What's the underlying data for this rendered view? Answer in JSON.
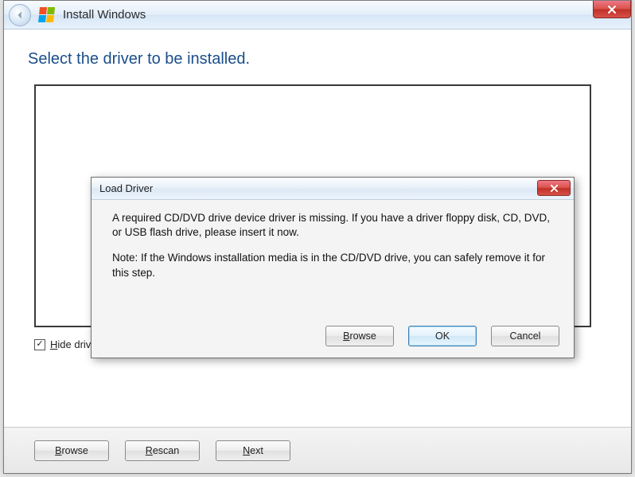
{
  "titlebar": {
    "title": "Install Windows"
  },
  "main": {
    "heading": "Select the driver to be installed.",
    "hide_checkbox_label": "Hide drivers that are not compatible with hardware on this computer.",
    "hide_checkbox_checked": true
  },
  "bottom": {
    "browse": "Browse",
    "rescan": "Rescan",
    "next": "Next"
  },
  "dialog": {
    "title": "Load Driver",
    "message1": "A required CD/DVD drive device driver is missing. If you have a driver floppy disk, CD, DVD, or USB flash drive, please insert it now.",
    "message2": "Note: If the Windows installation media is in the CD/DVD drive, you can safely remove it for this step.",
    "browse": "Browse",
    "ok": "OK",
    "cancel": "Cancel"
  }
}
